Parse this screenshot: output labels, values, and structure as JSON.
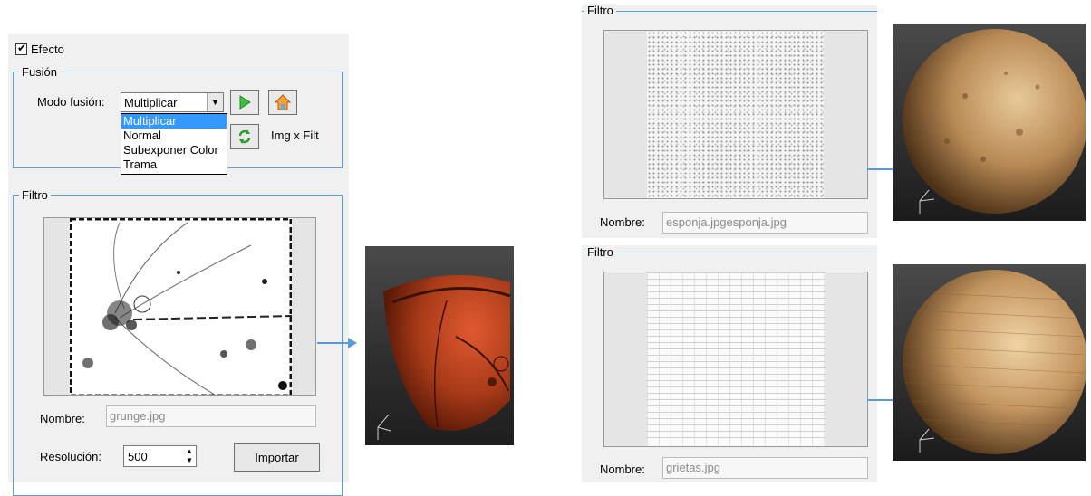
{
  "effect": {
    "label": "Efecto",
    "checked": true
  },
  "fusion": {
    "legend": "Fusión",
    "mode_label": "Modo fusión:",
    "mode_value": "Multiplicar",
    "mode_options": [
      "Multiplicar",
      "Normal",
      "Subexponer Color",
      "Trama"
    ],
    "img_filt_label": "Img x Filt"
  },
  "filter_main": {
    "legend": "Filtro",
    "name_label": "Nombre:",
    "name_value": "grunge.jpg",
    "resolution_label": "Resolución:",
    "resolution_value": "500",
    "import_label": "Importar"
  },
  "filter_top_right": {
    "legend": "Filtro",
    "name_label": "Nombre:",
    "name_value": "esponja.jpgesponja.jpg"
  },
  "filter_bottom_right": {
    "legend": "Filtro",
    "name_label": "Nombre:",
    "name_value": "grietas.jpg"
  },
  "colors": {
    "accent_border": "#5aa0dc",
    "arrow": "#5b9bd5",
    "selection": "#3399ff"
  }
}
